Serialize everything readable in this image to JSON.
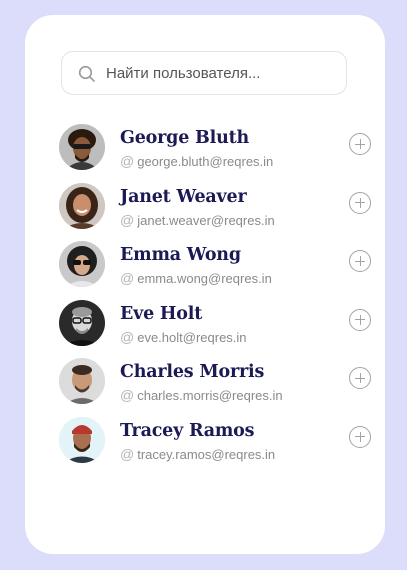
{
  "search": {
    "placeholder": "Найти пользователя...",
    "value": "",
    "icon": "search-icon"
  },
  "users": [
    {
      "name": "George Bluth",
      "email": "george.bluth@reqres.in",
      "avatar_bg": "#b9b9b9"
    },
    {
      "name": "Janet Weaver",
      "email": "janet.weaver@reqres.in",
      "avatar_bg": "#c9c2bd"
    },
    {
      "name": "Emma Wong",
      "email": "emma.wong@reqres.in",
      "avatar_bg": "#c7c7c7"
    },
    {
      "name": "Eve Holt",
      "email": "eve.holt@reqres.in",
      "avatar_bg": "#2a2a2a"
    },
    {
      "name": "Charles Morris",
      "email": "charles.morris@reqres.in",
      "avatar_bg": "#d9d9d9"
    },
    {
      "name": "Tracey Ramos",
      "email": "tracey.ramos@reqres.in",
      "avatar_bg": "#dff2f6"
    }
  ],
  "colors": {
    "background": "#dcdcfb",
    "card": "#ffffff",
    "name": "#1b1a55",
    "email": "#8a8a8a",
    "icon": "#a3a3a3"
  }
}
